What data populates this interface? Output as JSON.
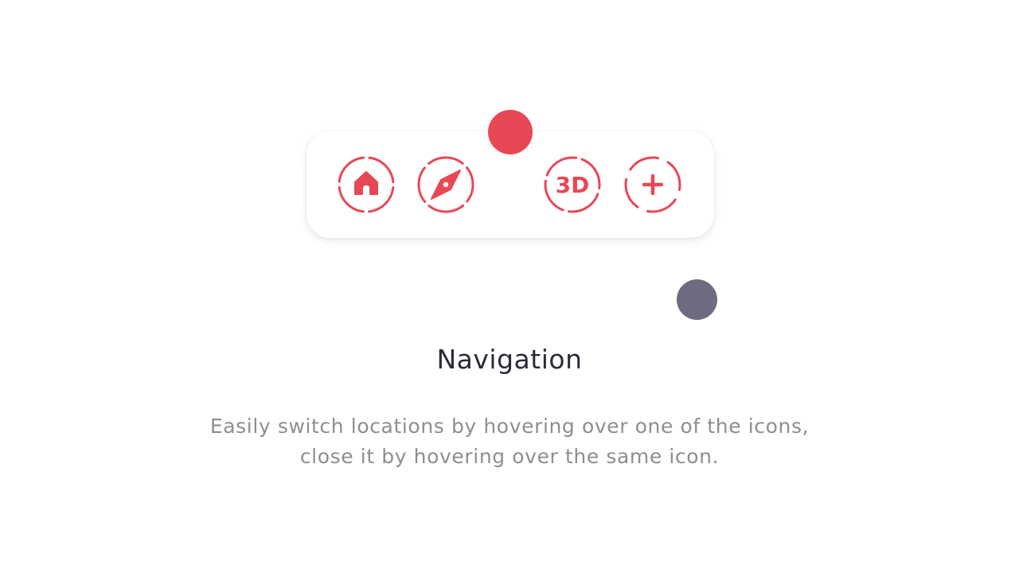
{
  "navigation_bar": {
    "buttons": [
      {
        "icon": "home-icon"
      },
      {
        "icon": "compass-icon"
      },
      {
        "icon": "3d-icon",
        "label": "3D"
      },
      {
        "icon": "plus-icon"
      }
    ],
    "accent_color": "#e84856"
  },
  "cursor": {
    "color": "#6e6b80"
  },
  "content": {
    "title": "Navigation",
    "description_line1": "Easily switch locations by hovering over one of the icons,",
    "description_line2": "close it by hovering over the same icon."
  },
  "colors": {
    "accent": "#e84856",
    "title": "#2b2a3c",
    "body_text": "#8e8e8e",
    "background": "#ffffff"
  }
}
